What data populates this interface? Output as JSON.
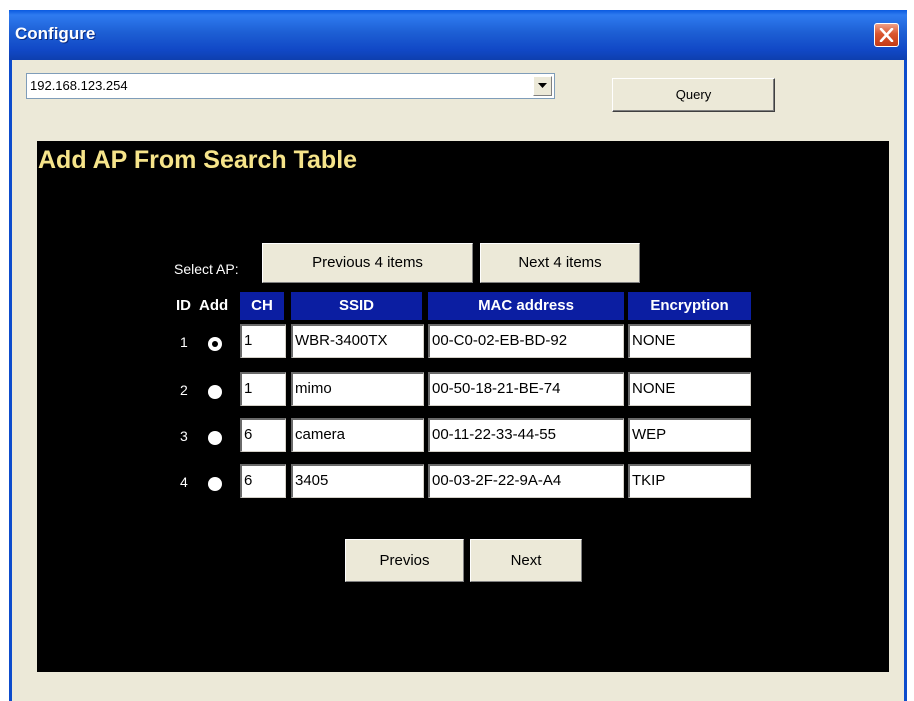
{
  "window": {
    "title": "Configure"
  },
  "toolbar": {
    "ip_value": "192.168.123.254",
    "query_label": "Query"
  },
  "panel": {
    "title": "Add AP From Search Table",
    "select_ap_label": "Select AP:",
    "prev_items_label": "Previous 4 items",
    "next_items_label": "Next 4 items",
    "headers": {
      "id": "ID",
      "add": "Add",
      "ch": "CH",
      "ssid": "SSID",
      "mac": "MAC address",
      "encryption": "Encryption"
    },
    "rows": [
      {
        "id": "1",
        "selected": true,
        "ch": "1",
        "ssid": "WBR-3400TX",
        "mac": "00-C0-02-EB-BD-92",
        "encryption": "NONE"
      },
      {
        "id": "2",
        "selected": false,
        "ch": "1",
        "ssid": "mimo",
        "mac": "00-50-18-21-BE-74",
        "encryption": "NONE"
      },
      {
        "id": "3",
        "selected": false,
        "ch": "6",
        "ssid": "camera",
        "mac": "00-11-22-33-44-55",
        "encryption": "WEP"
      },
      {
        "id": "4",
        "selected": false,
        "ch": "6",
        "ssid": "3405",
        "mac": "00-03-2F-22-9A-A4",
        "encryption": "TKIP"
      }
    ],
    "previous_label": "Previos",
    "next_label": "Next"
  },
  "colors": {
    "title_bar": "#1d5fd4",
    "panel_bg": "#000000",
    "panel_title": "#f6e48a",
    "header_bg": "#0b1ea2",
    "close_button": "#d9552e"
  }
}
